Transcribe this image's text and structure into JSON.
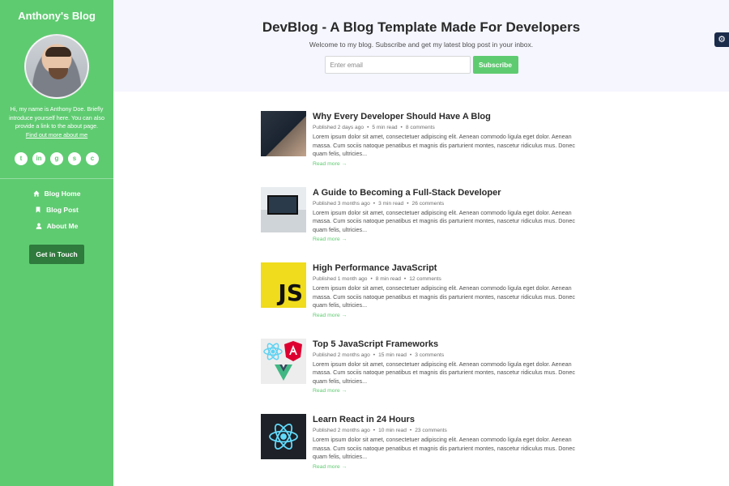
{
  "sidebar": {
    "blog_name": "Anthony's Blog",
    "bio": "Hi, my name is Anthony Doe. Briefly introduce yourself here. You can also provide a link to the about page.",
    "bio_link": "Find out more about me",
    "socials": [
      {
        "icon": "twitter-icon",
        "glyph": "t"
      },
      {
        "icon": "linkedin-icon",
        "glyph": "in"
      },
      {
        "icon": "github-icon",
        "glyph": "g"
      },
      {
        "icon": "stack-overflow-icon",
        "glyph": "s"
      },
      {
        "icon": "codepen-icon",
        "glyph": "c"
      }
    ],
    "nav": [
      {
        "label": "Blog Home",
        "icon": "home-icon"
      },
      {
        "label": "Blog Post",
        "icon": "bookmark-icon"
      },
      {
        "label": "About Me",
        "icon": "user-icon"
      }
    ],
    "cta_label": "Get in Touch"
  },
  "header": {
    "title": "DevBlog - A Blog Template Made For Developers",
    "subtitle": "Welcome to my blog. Subscribe and get my latest blog post in your inbox.",
    "email_placeholder": "Enter email",
    "subscribe_label": "Subscribe"
  },
  "settings": {
    "icon": "gear-icon"
  },
  "posts": [
    {
      "title": "Why Every Developer Should Have A Blog",
      "published": "Published 2 days ago",
      "read_time": "5 min read",
      "comments": "8 comments",
      "excerpt": "Lorem ipsum dolor sit amet, consectetuer adipiscing elit. Aenean commodo ligula eget dolor. Aenean massa. Cum sociis natoque penatibus et magnis dis parturient montes, nascetur ridiculus mus. Donec quam felis, ultricies...",
      "read_more": "Read more →"
    },
    {
      "title": "A Guide to Becoming a Full-Stack Developer",
      "published": "Published 3 months ago",
      "read_time": "3 min read",
      "comments": "26 comments",
      "excerpt": "Lorem ipsum dolor sit amet, consectetuer adipiscing elit. Aenean commodo ligula eget dolor. Aenean massa. Cum sociis natoque penatibus et magnis dis parturient montes, nascetur ridiculus mus. Donec quam felis, ultricies...",
      "read_more": "Read more →"
    },
    {
      "title": "High Performance JavaScript",
      "published": "Published 1 month ago",
      "read_time": "8 min read",
      "comments": "12 comments",
      "excerpt": "Lorem ipsum dolor sit amet, consectetuer adipiscing elit. Aenean commodo ligula eget dolor. Aenean massa. Cum sociis natoque penatibus et magnis dis parturient montes, nascetur ridiculus mus. Donec quam felis, ultricies...",
      "read_more": "Read more →",
      "thumb_text": "JS"
    },
    {
      "title": "Top 5 JavaScript Frameworks",
      "published": "Published 2 months ago",
      "read_time": "15 min read",
      "comments": "3 comments",
      "excerpt": "Lorem ipsum dolor sit amet, consectetuer adipiscing elit. Aenean commodo ligula eget dolor. Aenean massa. Cum sociis natoque penatibus et magnis dis parturient montes, nascetur ridiculus mus. Donec quam felis, ultricies...",
      "read_more": "Read more →"
    },
    {
      "title": "Learn React in 24 Hours",
      "published": "Published 2 months ago",
      "read_time": "10 min read",
      "comments": "23 comments",
      "excerpt": "Lorem ipsum dolor sit amet, consectetuer adipiscing elit. Aenean commodo ligula eget dolor. Aenean massa. Cum sociis natoque penatibus et magnis dis parturient montes, nascetur ridiculus mus. Donec quam felis, ultricies...",
      "read_more": "Read more →"
    }
  ],
  "colors": {
    "accent": "#5fcb71",
    "accent_dark": "#2f7a3d",
    "header_bg": "#f5f6fe",
    "settings_bg": "#1b2b4a"
  }
}
